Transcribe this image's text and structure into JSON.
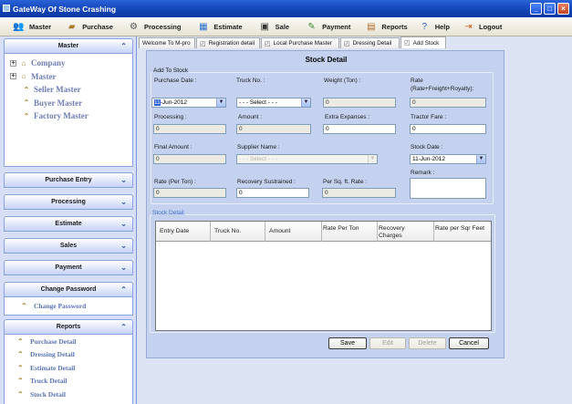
{
  "window": {
    "title": "GateWay Of Stone Crashing",
    "buttons": [
      "_",
      "□",
      "×"
    ]
  },
  "menu": [
    {
      "label": "Master",
      "icon": "people-icon"
    },
    {
      "label": "Purchase",
      "icon": "truck-icon"
    },
    {
      "label": "Processing",
      "icon": "gear-icon"
    },
    {
      "label": "Estimate",
      "icon": "calculator-icon"
    },
    {
      "label": "Sale",
      "icon": "money-icon"
    },
    {
      "label": "Payment",
      "icon": "pen-icon"
    },
    {
      "label": "Reports",
      "icon": "report-icon"
    },
    {
      "label": "Help",
      "icon": "help-icon"
    },
    {
      "label": "Logout",
      "icon": "logout-icon"
    }
  ],
  "sidebar": {
    "master": {
      "title": "Master",
      "items": [
        {
          "label": "Company",
          "toggle": "+"
        },
        {
          "label": "Master",
          "toggle": "+"
        },
        {
          "label": "Seller Master"
        },
        {
          "label": "Buyer Master"
        },
        {
          "label": "Factory Master"
        }
      ]
    },
    "collapsed": [
      "Purchase Entry",
      "Processing",
      "Estimate",
      "Sales",
      "Payment"
    ],
    "change_password": {
      "title": "Change Password",
      "items": [
        "Change Password"
      ]
    },
    "reports": {
      "title": "Reports",
      "items": [
        "Purchase Detail",
        "Dressing Detail",
        "Estimate Detail",
        "Truck Detail",
        "Stock Detail"
      ]
    }
  },
  "tabs": [
    "Welcome To M-pro",
    "Registration detail",
    "Local Purchase Master",
    "Dressing Detail",
    "Add Stock"
  ],
  "form": {
    "title": "Stock Detail",
    "group_add": "Add To Stock",
    "purchase_date": {
      "label": "Purchase Date :",
      "value_sel": "11",
      "value_rest": "-Jun-2012"
    },
    "truck_no": {
      "label": "Truck No. :",
      "value": "- - - Select - - -"
    },
    "weight": {
      "label": "Weight (Ton) :",
      "value": "0"
    },
    "rate": {
      "label": "Rate",
      "sublabel": "(Rate+Freight+Royalty):",
      "value": "0"
    },
    "processing": {
      "label": "Processing :",
      "value": "0"
    },
    "amount": {
      "label": "Amount :",
      "value": "0"
    },
    "extra": {
      "label": "Extra Expanses :",
      "value": "0"
    },
    "tractor": {
      "label": "Tractor Fare :",
      "value": "0"
    },
    "final_amount": {
      "label": "Final Amount :",
      "value": "0"
    },
    "supplier": {
      "label": "Supplier Name :",
      "value": "- - - Select - - -"
    },
    "stock_date": {
      "label": "Stock Date :",
      "value": "11-Jun-2012"
    },
    "remark": {
      "label": "Remark :",
      "value": ""
    },
    "rate_per_ton": {
      "label": "Rate (Per Ton) :",
      "value": "0"
    },
    "recovery": {
      "label": "Recovery Sustrained :",
      "value": "0"
    },
    "per_sqft": {
      "label": "Per Sq. ft. Rate :",
      "value": "0"
    },
    "group_stock": "Stock Detail",
    "grid_columns": [
      "Entry Date",
      "Truck No.",
      "Amount",
      "Rate Per Ton",
      "Recovery Charges",
      "Rate per Sqr Feet"
    ],
    "buttons": {
      "save": "Save",
      "edit": "Edit",
      "delete": "Delete",
      "cancel": "Cancel"
    }
  }
}
